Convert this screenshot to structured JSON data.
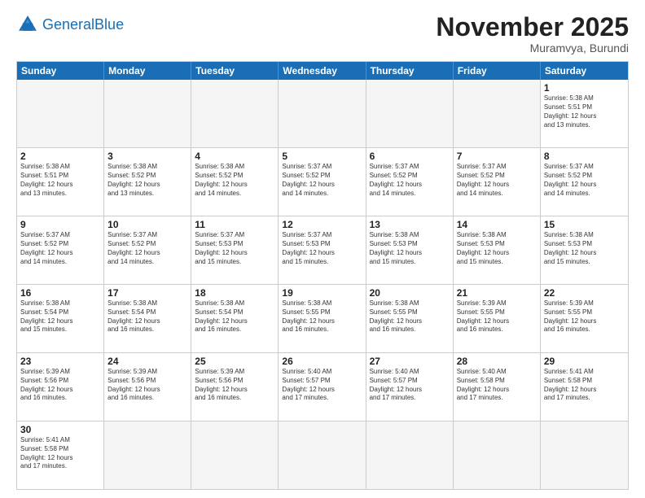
{
  "header": {
    "logo_general": "General",
    "logo_blue": "Blue",
    "month_title": "November 2025",
    "location": "Muramvya, Burundi"
  },
  "days_of_week": [
    "Sunday",
    "Monday",
    "Tuesday",
    "Wednesday",
    "Thursday",
    "Friday",
    "Saturday"
  ],
  "rows": [
    [
      {
        "day": "",
        "info": "",
        "empty": true
      },
      {
        "day": "",
        "info": "",
        "empty": true
      },
      {
        "day": "",
        "info": "",
        "empty": true
      },
      {
        "day": "",
        "info": "",
        "empty": true
      },
      {
        "day": "",
        "info": "",
        "empty": true
      },
      {
        "day": "",
        "info": "",
        "empty": true
      },
      {
        "day": "1",
        "info": "Sunrise: 5:38 AM\nSunset: 5:51 PM\nDaylight: 12 hours\nand 13 minutes.",
        "empty": false
      }
    ],
    [
      {
        "day": "2",
        "info": "Sunrise: 5:38 AM\nSunset: 5:51 PM\nDaylight: 12 hours\nand 13 minutes.",
        "empty": false
      },
      {
        "day": "3",
        "info": "Sunrise: 5:38 AM\nSunset: 5:52 PM\nDaylight: 12 hours\nand 13 minutes.",
        "empty": false
      },
      {
        "day": "4",
        "info": "Sunrise: 5:38 AM\nSunset: 5:52 PM\nDaylight: 12 hours\nand 14 minutes.",
        "empty": false
      },
      {
        "day": "5",
        "info": "Sunrise: 5:37 AM\nSunset: 5:52 PM\nDaylight: 12 hours\nand 14 minutes.",
        "empty": false
      },
      {
        "day": "6",
        "info": "Sunrise: 5:37 AM\nSunset: 5:52 PM\nDaylight: 12 hours\nand 14 minutes.",
        "empty": false
      },
      {
        "day": "7",
        "info": "Sunrise: 5:37 AM\nSunset: 5:52 PM\nDaylight: 12 hours\nand 14 minutes.",
        "empty": false
      },
      {
        "day": "8",
        "info": "Sunrise: 5:37 AM\nSunset: 5:52 PM\nDaylight: 12 hours\nand 14 minutes.",
        "empty": false
      }
    ],
    [
      {
        "day": "9",
        "info": "Sunrise: 5:37 AM\nSunset: 5:52 PM\nDaylight: 12 hours\nand 14 minutes.",
        "empty": false
      },
      {
        "day": "10",
        "info": "Sunrise: 5:37 AM\nSunset: 5:52 PM\nDaylight: 12 hours\nand 14 minutes.",
        "empty": false
      },
      {
        "day": "11",
        "info": "Sunrise: 5:37 AM\nSunset: 5:53 PM\nDaylight: 12 hours\nand 15 minutes.",
        "empty": false
      },
      {
        "day": "12",
        "info": "Sunrise: 5:37 AM\nSunset: 5:53 PM\nDaylight: 12 hours\nand 15 minutes.",
        "empty": false
      },
      {
        "day": "13",
        "info": "Sunrise: 5:38 AM\nSunset: 5:53 PM\nDaylight: 12 hours\nand 15 minutes.",
        "empty": false
      },
      {
        "day": "14",
        "info": "Sunrise: 5:38 AM\nSunset: 5:53 PM\nDaylight: 12 hours\nand 15 minutes.",
        "empty": false
      },
      {
        "day": "15",
        "info": "Sunrise: 5:38 AM\nSunset: 5:53 PM\nDaylight: 12 hours\nand 15 minutes.",
        "empty": false
      }
    ],
    [
      {
        "day": "16",
        "info": "Sunrise: 5:38 AM\nSunset: 5:54 PM\nDaylight: 12 hours\nand 15 minutes.",
        "empty": false
      },
      {
        "day": "17",
        "info": "Sunrise: 5:38 AM\nSunset: 5:54 PM\nDaylight: 12 hours\nand 16 minutes.",
        "empty": false
      },
      {
        "day": "18",
        "info": "Sunrise: 5:38 AM\nSunset: 5:54 PM\nDaylight: 12 hours\nand 16 minutes.",
        "empty": false
      },
      {
        "day": "19",
        "info": "Sunrise: 5:38 AM\nSunset: 5:55 PM\nDaylight: 12 hours\nand 16 minutes.",
        "empty": false
      },
      {
        "day": "20",
        "info": "Sunrise: 5:38 AM\nSunset: 5:55 PM\nDaylight: 12 hours\nand 16 minutes.",
        "empty": false
      },
      {
        "day": "21",
        "info": "Sunrise: 5:39 AM\nSunset: 5:55 PM\nDaylight: 12 hours\nand 16 minutes.",
        "empty": false
      },
      {
        "day": "22",
        "info": "Sunrise: 5:39 AM\nSunset: 5:55 PM\nDaylight: 12 hours\nand 16 minutes.",
        "empty": false
      }
    ],
    [
      {
        "day": "23",
        "info": "Sunrise: 5:39 AM\nSunset: 5:56 PM\nDaylight: 12 hours\nand 16 minutes.",
        "empty": false
      },
      {
        "day": "24",
        "info": "Sunrise: 5:39 AM\nSunset: 5:56 PM\nDaylight: 12 hours\nand 16 minutes.",
        "empty": false
      },
      {
        "day": "25",
        "info": "Sunrise: 5:39 AM\nSunset: 5:56 PM\nDaylight: 12 hours\nand 16 minutes.",
        "empty": false
      },
      {
        "day": "26",
        "info": "Sunrise: 5:40 AM\nSunset: 5:57 PM\nDaylight: 12 hours\nand 17 minutes.",
        "empty": false
      },
      {
        "day": "27",
        "info": "Sunrise: 5:40 AM\nSunset: 5:57 PM\nDaylight: 12 hours\nand 17 minutes.",
        "empty": false
      },
      {
        "day": "28",
        "info": "Sunrise: 5:40 AM\nSunset: 5:58 PM\nDaylight: 12 hours\nand 17 minutes.",
        "empty": false
      },
      {
        "day": "29",
        "info": "Sunrise: 5:41 AM\nSunset: 5:58 PM\nDaylight: 12 hours\nand 17 minutes.",
        "empty": false
      }
    ],
    [
      {
        "day": "30",
        "info": "Sunrise: 5:41 AM\nSunset: 5:58 PM\nDaylight: 12 hours\nand 17 minutes.",
        "empty": false
      },
      {
        "day": "",
        "info": "",
        "empty": true
      },
      {
        "day": "",
        "info": "",
        "empty": true
      },
      {
        "day": "",
        "info": "",
        "empty": true
      },
      {
        "day": "",
        "info": "",
        "empty": true
      },
      {
        "day": "",
        "info": "",
        "empty": true
      },
      {
        "day": "",
        "info": "",
        "empty": true
      }
    ]
  ]
}
